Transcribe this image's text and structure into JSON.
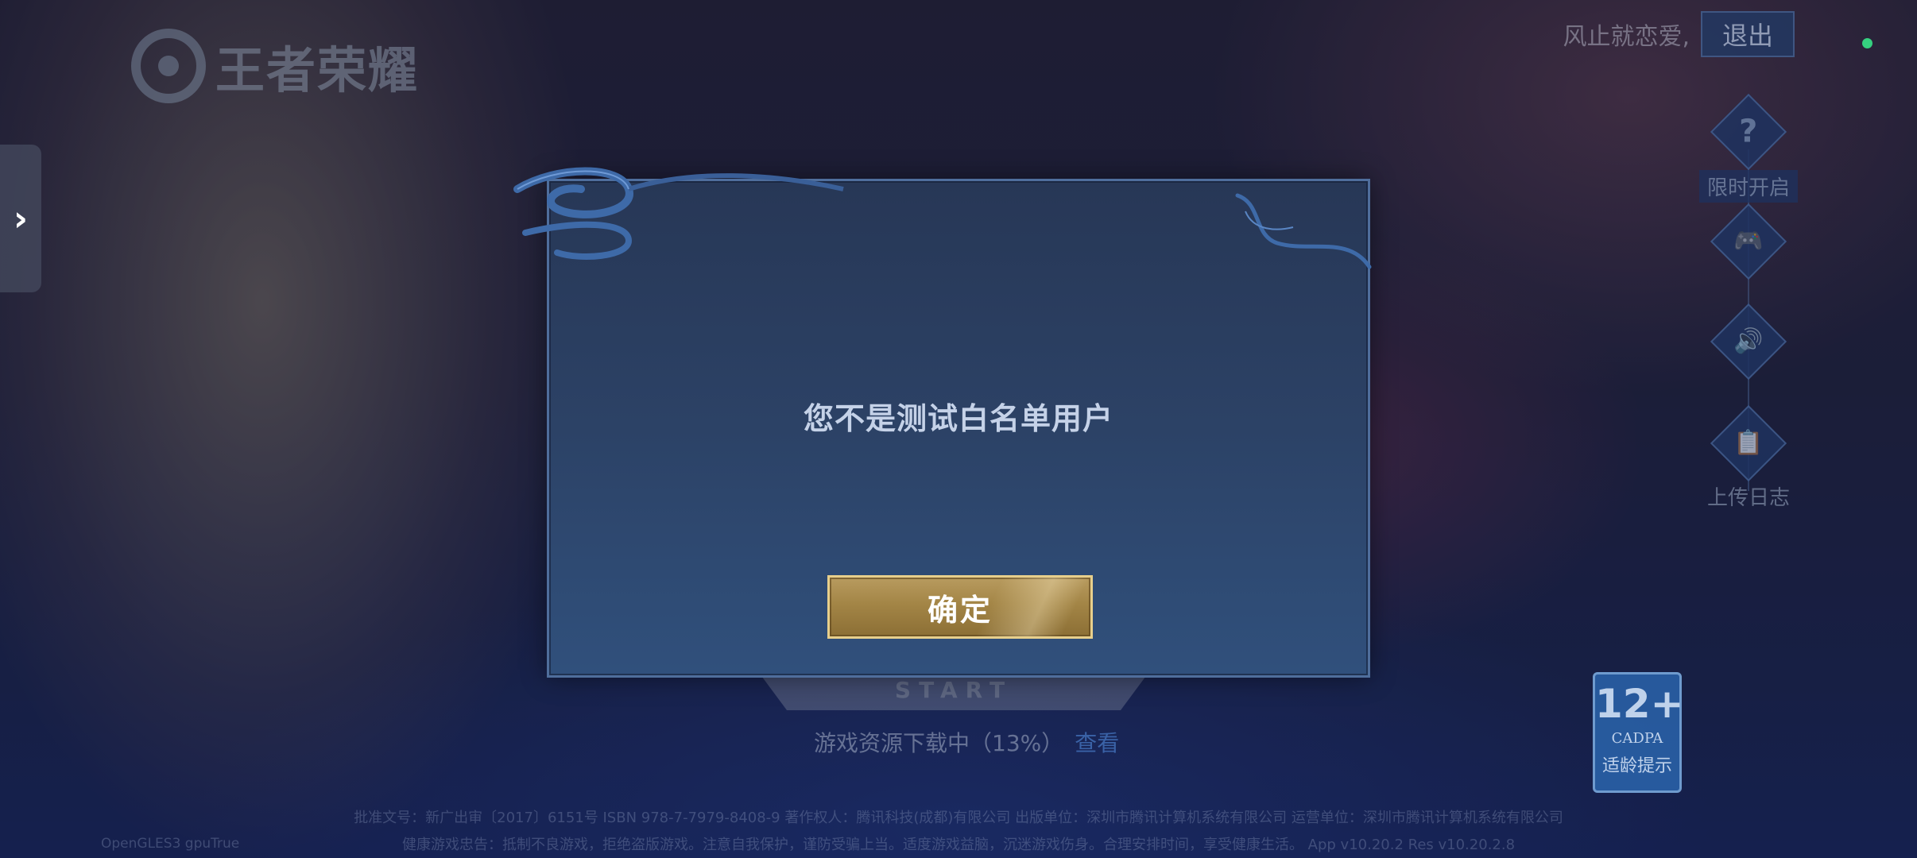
{
  "header": {
    "logo_text": "王者荣耀",
    "user_greeting": "风止就恋爱,",
    "logout_label": "退出"
  },
  "side_tools": [
    {
      "icon": "help-icon",
      "glyph": "?",
      "label": "限时开启"
    },
    {
      "icon": "gamepad-icon",
      "glyph": "🎮",
      "label": ""
    },
    {
      "icon": "speaker-icon",
      "glyph": "🔊",
      "label": ""
    },
    {
      "icon": "clipboard-icon",
      "glyph": "📋",
      "label": "上传日志"
    }
  ],
  "drawer": {
    "icon": "chevron-right-icon",
    "glyph": "›"
  },
  "start": {
    "label": "START"
  },
  "download": {
    "status": "游戏资源下载中（13%）",
    "progress_percent": 13,
    "view_label": "查看"
  },
  "age_rating": {
    "age": "12+",
    "org": "CADPA",
    "tip": "适龄提示"
  },
  "footer": {
    "line1": "批准文号：新广出审〔2017〕6151号  ISBN 978-7-7979-8408-9  著作权人：腾讯科技(成都)有限公司  出版单位：深圳市腾讯计算机系统有限公司  运营单位：深圳市腾讯计算机系统有限公司",
    "line2": "健康游戏忠告：抵制不良游戏，拒绝盗版游戏。注意自我保护，谨防受骗上当。适度游戏益脑，沉迷游戏伤身。合理安排时间，享受健康生活。  App v10.20.2  Res v10.20.2.8",
    "renderer": "OpenGLES3 gpuTrue"
  },
  "dialog": {
    "message": "您不是测试白名单用户",
    "confirm_label": "确定"
  },
  "colors": {
    "status_dot": "#35d07f",
    "confirm_gold": "#a38546",
    "dialog_bg": "#2c4266"
  }
}
